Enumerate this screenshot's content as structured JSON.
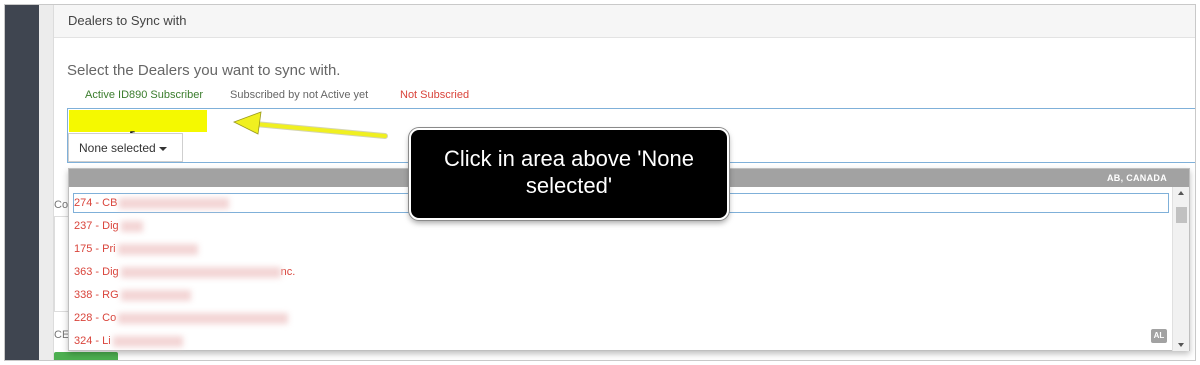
{
  "panel": {
    "title": "Dealers to Sync with",
    "instruction": "Select the Dealers you want to sync with."
  },
  "legend": {
    "active": "Active ID890 Subscriber",
    "inactive": "Subscribed by not Active yet",
    "not_subscribed": "Not Subscried"
  },
  "select": {
    "button_label": "None selected"
  },
  "side_labels": {
    "c": "Co",
    "ce": "CE"
  },
  "dropdown": {
    "group_header": "AB, CANADA",
    "group_badge": "AL",
    "items": [
      {
        "label": "274 - CB"
      },
      {
        "label": "237 - Dig"
      },
      {
        "label": "175 - Pri"
      },
      {
        "label": "363 - Dig",
        "suffix": "nc."
      },
      {
        "label": "338 - RG"
      },
      {
        "label": "228 - Co"
      },
      {
        "label": "324 - Li"
      }
    ]
  },
  "callout": {
    "text": "Click in area above 'None selected'"
  },
  "colors": {
    "highlight": "#f5f900",
    "arrow": "#f0f020",
    "active": "#3b7d2d",
    "not_subscribed": "#d9443b",
    "rail": "#3f4550"
  }
}
